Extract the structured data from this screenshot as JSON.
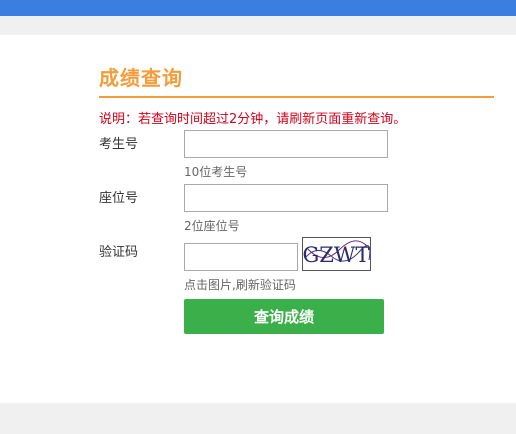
{
  "colors": {
    "header_bar": "#3a7fe0",
    "title": "#f39c3a",
    "notice": "#d0021b",
    "submit_bg": "#3bb04a",
    "page_bg": "#f0f0f0"
  },
  "form": {
    "title": "成绩查询",
    "notice": "说明：若查询时间超过2分钟，请刷新页面重新查询。",
    "exam_number": {
      "label": "考生号",
      "value": "",
      "hint": "10位考生号"
    },
    "seat_number": {
      "label": "座位号",
      "value": "",
      "hint": "2位座位号"
    },
    "captcha": {
      "label": "验证码",
      "value": "",
      "image_text": "GZWT",
      "hint": "点击图片,刷新验证码"
    },
    "submit_label": "查询成绩"
  }
}
